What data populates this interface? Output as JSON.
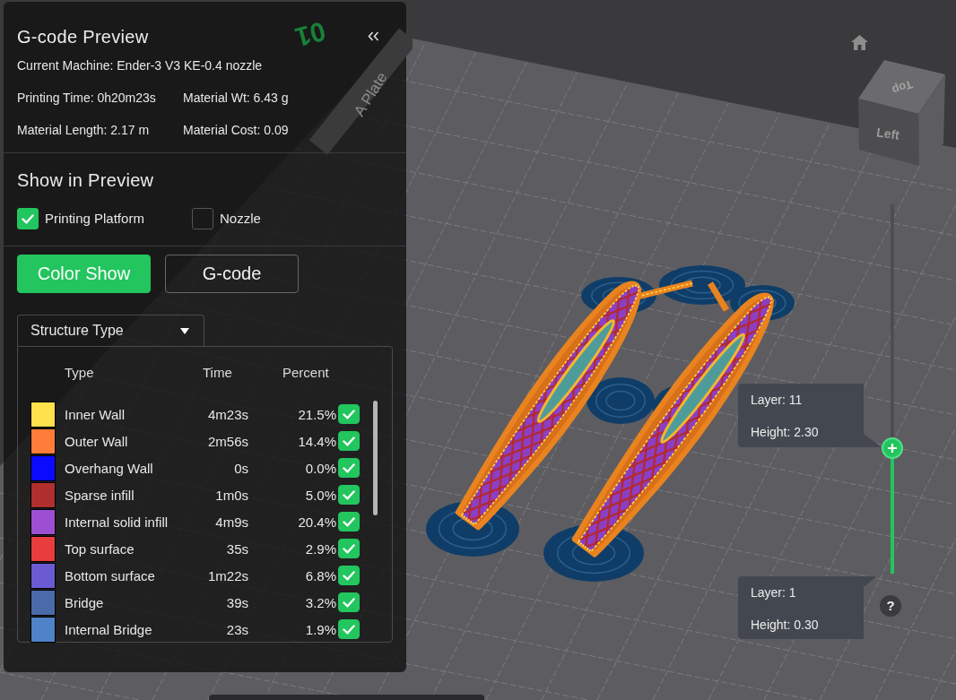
{
  "panel": {
    "title": "G-code Preview",
    "machine": "Current Machine: Ender-3 V3 KE-0.4 nozzle",
    "stats": [
      "Printing Time: 0h20m23s",
      "Material Wt: 6.43 g",
      "Material Length: 2.17 m",
      "Material Cost: 0.09"
    ]
  },
  "show_in_preview": {
    "title": "Show in Preview",
    "options": [
      {
        "label": "Printing Platform",
        "checked": true
      },
      {
        "label": "Nozzle",
        "checked": false
      }
    ]
  },
  "view_modes": [
    {
      "label": "Color Show",
      "selected": true
    },
    {
      "label": "G-code",
      "selected": false
    }
  ],
  "legend": {
    "dropdown": "Structure Type",
    "columns": [
      "Type",
      "Time",
      "Percent"
    ],
    "rows": [
      {
        "type": "Inner Wall",
        "time": "4m23s",
        "percent": "21.5%",
        "color": "#ffe14d",
        "checked": true
      },
      {
        "type": "Outer Wall",
        "time": "2m56s",
        "percent": "14.4%",
        "color": "#ff7d38",
        "checked": true
      },
      {
        "type": "Overhang Wall",
        "time": "0s",
        "percent": "0.0%",
        "color": "#0a0aff",
        "checked": true
      },
      {
        "type": "Sparse infill",
        "time": "1m0s",
        "percent": "5.0%",
        "color": "#b0302d",
        "checked": true
      },
      {
        "type": "Internal solid infill",
        "time": "4m9s",
        "percent": "20.4%",
        "color": "#9d4fd2",
        "checked": true
      },
      {
        "type": "Top surface",
        "time": "35s",
        "percent": "2.9%",
        "color": "#e93c3c",
        "checked": true
      },
      {
        "type": "Bottom surface",
        "time": "1m22s",
        "percent": "6.8%",
        "color": "#6b5bd3",
        "checked": true
      },
      {
        "type": "Bridge",
        "time": "39s",
        "percent": "3.2%",
        "color": "#4a6aaa",
        "checked": true
      },
      {
        "type": "Internal Bridge",
        "time": "23s",
        "percent": "1.9%",
        "color": "#4f83c8",
        "checked": true
      }
    ]
  },
  "plate": {
    "number": "01",
    "label": "A Plate"
  },
  "view_cube": {
    "faces": [
      {
        "kind": "top",
        "label": "Top"
      },
      {
        "kind": "left",
        "label": "Left"
      }
    ]
  },
  "layer_slider": {
    "level": 0.34,
    "upper": {
      "layer": "Layer: 11",
      "height": "Height: 2.30"
    },
    "lower": {
      "layer": "Layer: 1",
      "height": "Height: 0.30"
    }
  },
  "help_button": {
    "label": "?"
  }
}
